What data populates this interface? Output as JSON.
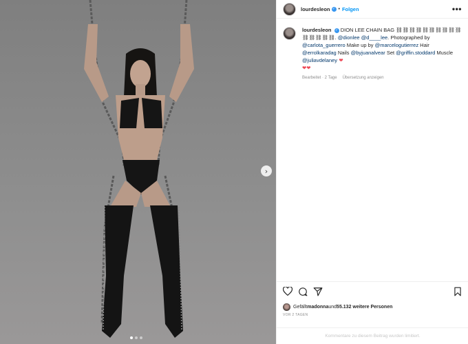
{
  "post": {
    "username": "lourdesleon",
    "follow_label": "Folgen",
    "separator": "•",
    "more_label": "•••",
    "next_arrow": "›"
  },
  "caption": {
    "username": "lourdesleon",
    "text_1": " DION LEE CHAIN BAG ⛓⛓⛓⛓⛓⛓⛓⛓⛓⛓⛓⛓⛓⛓⛓. ",
    "m_dionlee": "@dionlee",
    "m_dlee": "@d____lee",
    "text_2": ". Photographed by ",
    "m_carlota": "@carlota_guerrero",
    "text_3": " Make up by ",
    "m_marcelo": "@marcelogutierrez",
    "text_4": " Hair ",
    "m_errol": "@errolkaradag",
    "text_5": " Nails ",
    "m_juan": "@byjuanalvear",
    "text_6": " Set ",
    "m_griffin": "@griffin.stoddard",
    "text_7": " Muscle ",
    "m_julia": "@juliavdelaney",
    "hearts_inline": " ❤",
    "hearts_line": "❤❤"
  },
  "meta": {
    "edited": "Bearbeitet · 2 Tage",
    "translate": "Übersetzung anzeigen"
  },
  "likes": {
    "prefix": "Gefällt ",
    "liker": "madonna",
    "middle": " und ",
    "count": "55.132 weitere Personen"
  },
  "date": "VOR 2 TAGEN",
  "comments_limited": "Kommentare zu diesem Beitrag wurden limitiert.",
  "carousel": {
    "total": 3,
    "active_index": 0
  },
  "colors": {
    "accent": "#0095f6",
    "verified": "#3897f0",
    "heart": "#ed4956",
    "mention": "#00376b",
    "photo_bg": "#8b8b8b"
  },
  "icons": [
    "verified-icon",
    "more-icon",
    "heart-icon",
    "comment-icon",
    "share-icon",
    "bookmark-icon",
    "next-arrow-icon"
  ]
}
